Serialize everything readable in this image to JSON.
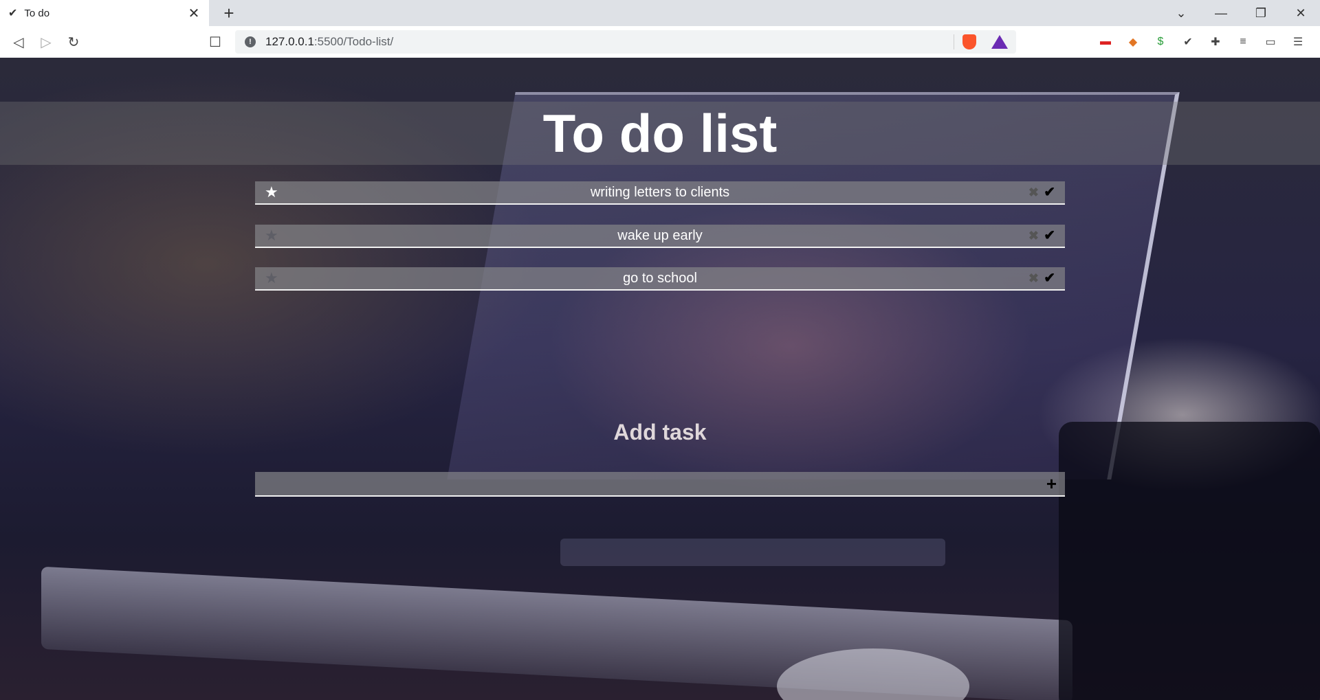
{
  "browser": {
    "tab_title": "To do",
    "tab_close": "✕",
    "new_tab": "+",
    "url_host": "127.0.0.1",
    "url_rest": ":5500/Todo-list/",
    "window_controls": {
      "tabs_menu": "⌄",
      "minimize": "—",
      "restore": "❐",
      "close": "✕"
    }
  },
  "page": {
    "title": "To do list",
    "tasks": [
      {
        "text": "writing letters to clients",
        "starred": true
      },
      {
        "text": "wake up early",
        "starred": false
      },
      {
        "text": "go to school",
        "starred": false
      }
    ],
    "add_title": "Add task",
    "add_placeholder": "",
    "add_button": "+",
    "icons": {
      "star": "★",
      "delete": "✖",
      "done": "✔"
    },
    "colors": {
      "star_active": "#ffffff",
      "star_inactive": "#5e5e66"
    }
  }
}
